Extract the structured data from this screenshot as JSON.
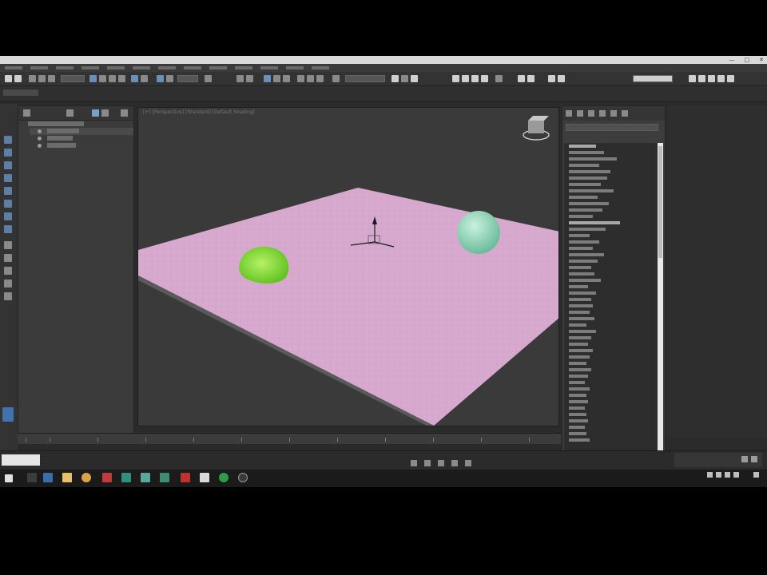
{
  "window": {
    "title": "",
    "controls": [
      "—",
      "□",
      "✕"
    ]
  },
  "viewport": {
    "label": "[+] [Perspective] [Standard] [Default Shading]",
    "scene": {
      "plane_color": "#d8a9cf",
      "blob_color": "#86e33b",
      "sphere_color": "#9fe0c4",
      "background": "#3a3a3a"
    }
  },
  "statusbar": {
    "text": "",
    "maxscript_label": ""
  },
  "taskbar": {
    "clock_time": "",
    "clock_date": ""
  },
  "icons": {
    "start": "windows-icon",
    "viewcube": "viewcube-icon",
    "gizmo": "transform-gizmo-icon"
  }
}
